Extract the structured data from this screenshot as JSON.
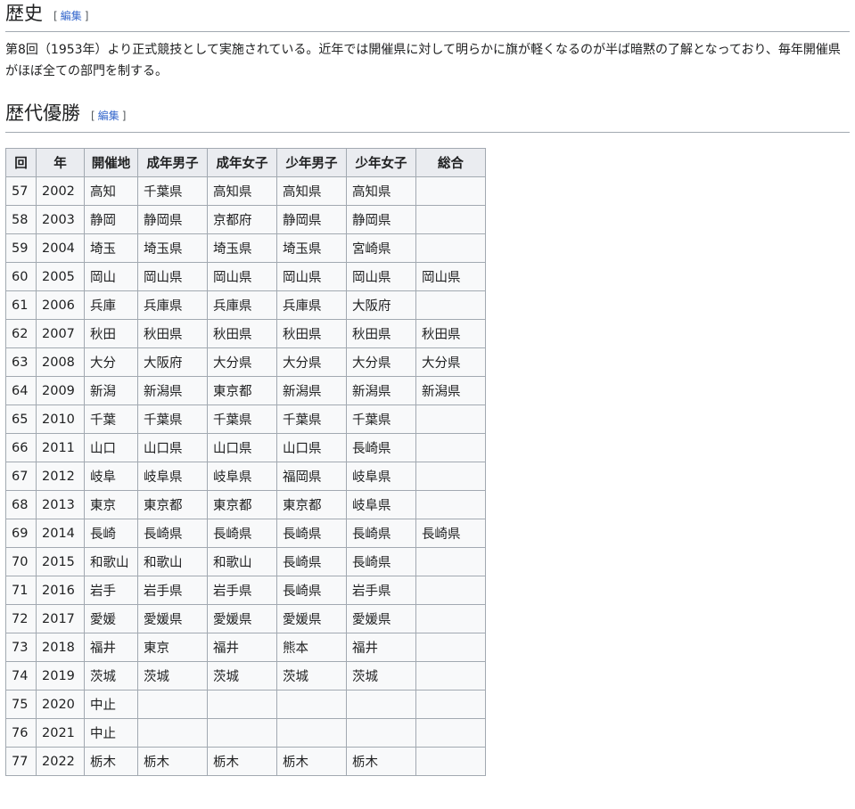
{
  "history": {
    "title": "歴史",
    "edit_open": "[",
    "edit_label": "編集",
    "edit_close": "]",
    "text": "第8回（1953年）より正式競技として実施されている。近年では開催県に対して明らかに旗が軽くなるのが半ば暗黙の了解となっており、毎年開催県がほぼ全ての部門を制する。"
  },
  "winners": {
    "title": "歴代優勝",
    "edit_open": "[",
    "edit_label": "編集",
    "edit_close": "]",
    "headers": [
      "回",
      "年",
      "開催地",
      "成年男子",
      "成年女子",
      "少年男子",
      "少年女子",
      "総合"
    ],
    "rows": [
      [
        "57",
        "2002",
        "高知",
        "千葉県",
        "高知県",
        "高知県",
        "高知県",
        ""
      ],
      [
        "58",
        "2003",
        "静岡",
        "静岡県",
        "京都府",
        "静岡県",
        "静岡県",
        ""
      ],
      [
        "59",
        "2004",
        "埼玉",
        "埼玉県",
        "埼玉県",
        "埼玉県",
        "宮崎県",
        ""
      ],
      [
        "60",
        "2005",
        "岡山",
        "岡山県",
        "岡山県",
        "岡山県",
        "岡山県",
        "岡山県"
      ],
      [
        "61",
        "2006",
        "兵庫",
        "兵庫県",
        "兵庫県",
        "兵庫県",
        "大阪府",
        ""
      ],
      [
        "62",
        "2007",
        "秋田",
        "秋田県",
        "秋田県",
        "秋田県",
        "秋田県",
        "秋田県"
      ],
      [
        "63",
        "2008",
        "大分",
        "大阪府",
        "大分県",
        "大分県",
        "大分県",
        "大分県"
      ],
      [
        "64",
        "2009",
        "新潟",
        "新潟県",
        "東京都",
        "新潟県",
        "新潟県",
        "新潟県"
      ],
      [
        "65",
        "2010",
        "千葉",
        "千葉県",
        "千葉県",
        "千葉県",
        "千葉県",
        ""
      ],
      [
        "66",
        "2011",
        "山口",
        "山口県",
        "山口県",
        "山口県",
        "長崎県",
        ""
      ],
      [
        "67",
        "2012",
        "岐阜",
        "岐阜県",
        "岐阜県",
        "福岡県",
        "岐阜県",
        ""
      ],
      [
        "68",
        "2013",
        "東京",
        "東京都",
        "東京都",
        "東京都",
        "岐阜県",
        ""
      ],
      [
        "69",
        "2014",
        "長崎",
        "長崎県",
        "長崎県",
        "長崎県",
        "長崎県",
        "長崎県"
      ],
      [
        "70",
        "2015",
        "和歌山",
        "和歌山",
        "和歌山",
        "長崎県",
        "長崎県",
        ""
      ],
      [
        "71",
        "2016",
        "岩手",
        "岩手県",
        "岩手県",
        "長崎県",
        "岩手県",
        ""
      ],
      [
        "72",
        "2017",
        "愛媛",
        "愛媛県",
        "愛媛県",
        "愛媛県",
        "愛媛県",
        ""
      ],
      [
        "73",
        "2018",
        "福井",
        "東京",
        "福井",
        "熊本",
        "福井",
        ""
      ],
      [
        "74",
        "2019",
        "茨城",
        "茨城",
        "茨城",
        "茨城",
        "茨城",
        ""
      ],
      [
        "75",
        "2020",
        "中止",
        "",
        "",
        "",
        "",
        ""
      ],
      [
        "76",
        "2021",
        "中止",
        "",
        "",
        "",
        "",
        ""
      ],
      [
        "77",
        "2022",
        "栃木",
        "栃木",
        "栃木",
        "栃木",
        "栃木",
        ""
      ]
    ]
  }
}
